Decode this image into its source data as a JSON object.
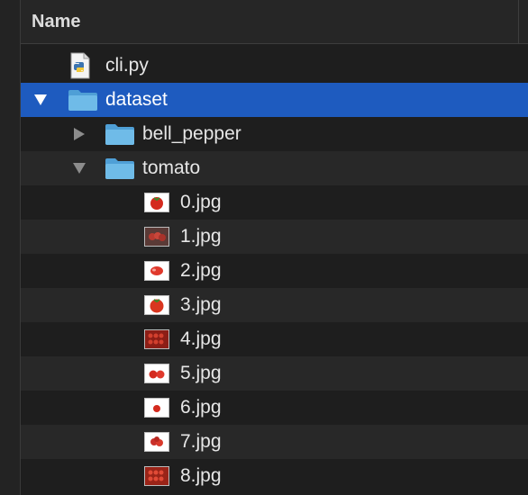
{
  "header": {
    "name_label": "Name"
  },
  "rows": [
    {
      "label": "cli.py",
      "kind": "python-file",
      "icon": "python-file-icon"
    },
    {
      "label": "dataset",
      "kind": "folder",
      "expanded": true,
      "selected": true,
      "icon": "folder-icon"
    },
    {
      "label": "bell_pepper",
      "kind": "folder",
      "expanded": false,
      "icon": "folder-icon"
    },
    {
      "label": "tomato",
      "kind": "folder",
      "expanded": true,
      "icon": "folder-icon"
    },
    {
      "label": "0.jpg",
      "kind": "image",
      "icon": "image-thumbnail-icon"
    },
    {
      "label": "1.jpg",
      "kind": "image",
      "icon": "image-thumbnail-icon"
    },
    {
      "label": "2.jpg",
      "kind": "image",
      "icon": "image-thumbnail-icon"
    },
    {
      "label": "3.jpg",
      "kind": "image",
      "icon": "image-thumbnail-icon"
    },
    {
      "label": "4.jpg",
      "kind": "image",
      "icon": "image-thumbnail-icon"
    },
    {
      "label": "5.jpg",
      "kind": "image",
      "icon": "image-thumbnail-icon"
    },
    {
      "label": "6.jpg",
      "kind": "image",
      "icon": "image-thumbnail-icon"
    },
    {
      "label": "7.jpg",
      "kind": "image",
      "icon": "image-thumbnail-icon"
    },
    {
      "label": "8.jpg",
      "kind": "image",
      "icon": "image-thumbnail-icon"
    }
  ],
  "colors": {
    "background": "#1e1e1e",
    "row_alt": "#282828",
    "selection": "#1e5bbf",
    "folder": "#5aaee0",
    "text": "#e6e6e6"
  }
}
